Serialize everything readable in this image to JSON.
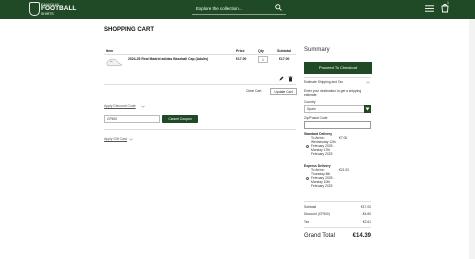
{
  "header": {
    "logo_small": "FAMOUS",
    "logo_main": "FOOTBALL",
    "logo_sub": "SHIRTS",
    "search_placeholder": "Explore the collection...",
    "cart_count": "1"
  },
  "cart": {
    "title": "SHOPPING CART",
    "columns": {
      "item": "Item",
      "price": "Price",
      "qty": "Qty",
      "subtotal": "Subtotal"
    },
    "item": {
      "name": "2024-25 Real Madrid adidas Baseball Cap (Adults)",
      "price": "€17.00",
      "qty": "1",
      "subtotal": "€17.00"
    },
    "clear_label": "Clear Cart",
    "update_label": "Update Cart",
    "discount_label": "Apply Discount Code",
    "coupon_value": "CF500",
    "cancel_coupon_label": "Cancel Coupon",
    "gift_card_label": "Apply Gift Card"
  },
  "summary": {
    "title": "Summary",
    "checkout_label": "Proceed To Checkout",
    "shipping_heading": "Estimate Shipping and Tax",
    "shipping_intro_1": "Enter your destination to get a shipping",
    "shipping_intro_2": "estimate.",
    "country_label": "Country",
    "country_value": "Spain",
    "zip_label": "Zip/Postal Code",
    "standard": {
      "title": "Standard Delivery",
      "arrive": "To Arrive:",
      "price": "€7.00",
      "lines": [
        "Wednesday 12th",
        "February 2025 -",
        "Monday 17th",
        "February 2025"
      ]
    },
    "express": {
      "title": "Express Delivery",
      "arrive": "To Arrive:",
      "price": "€21.00",
      "lines": [
        "Thursday 6th",
        "February 2025 -",
        "Monday 10th",
        "February 2025"
      ]
    },
    "totals": [
      {
        "label": "Subtotal",
        "value": "€17.00"
      },
      {
        "label": "Discount (CF500)",
        "value": "-€4.60"
      },
      {
        "label": "Tax",
        "value": "€2.61"
      }
    ],
    "grand_label": "Grand Total",
    "grand_value": "€14.39"
  },
  "colors": {
    "brand_green": "#1f4a25"
  },
  "icons": [
    "search-icon",
    "menu-icon",
    "cart-icon",
    "edit-icon",
    "trash-icon",
    "chevron-down-icon",
    "chevron-up-icon"
  ]
}
